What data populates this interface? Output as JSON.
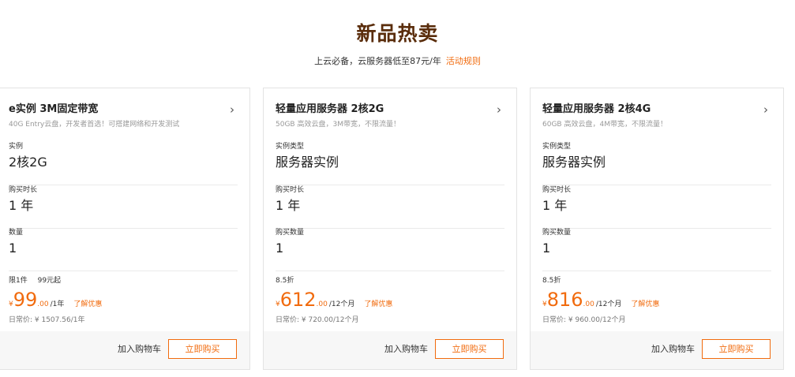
{
  "header": {
    "title": "新品热卖",
    "subtitle": "上云必备，云服务器低至87元/年",
    "rule_link": "活动规则"
  },
  "colors": {
    "accent": "#f16b0e",
    "title": "#5a2d0c"
  },
  "cards": [
    {
      "title": "e实例 3M固定带宽",
      "desc": "40G Entry云盘，开发者首选！可搭建网络和开发测试",
      "arrow": "›",
      "fields": [
        {
          "label": "实例",
          "value": "2核2G"
        },
        {
          "label": "购买时长",
          "value": "1 年"
        },
        {
          "label": "数量",
          "value": "1"
        }
      ],
      "tags": [
        "限1件",
        "99元起"
      ],
      "price": {
        "yen": "¥",
        "int": "99",
        "dec": ".00",
        "unit": "/1年"
      },
      "discount": "了解优惠",
      "original": "日常价: ¥ 1507.56/1年",
      "cart_label": "加入购物车",
      "buy_label": "立即购买"
    },
    {
      "title": "轻量应用服务器 2核2G",
      "desc": "50GB 高效云盘，3M带宽，不限流量！",
      "arrow": "›",
      "fields": [
        {
          "label": "实例类型",
          "value": "服务器实例"
        },
        {
          "label": "购买时长",
          "value": "1 年"
        },
        {
          "label": "购买数量",
          "value": "1"
        }
      ],
      "tags": [
        "8.5折"
      ],
      "price": {
        "yen": "¥",
        "int": "612",
        "dec": ".00",
        "unit": "/12个月"
      },
      "discount": "了解优惠",
      "original": "日常价: ¥ 720.00/12个月",
      "cart_label": "加入购物车",
      "buy_label": "立即购买"
    },
    {
      "title": "轻量应用服务器 2核4G",
      "desc": "60GB 高效云盘，4M带宽，不限流量！",
      "arrow": "›",
      "fields": [
        {
          "label": "实例类型",
          "value": "服务器实例"
        },
        {
          "label": "购买时长",
          "value": "1 年"
        },
        {
          "label": "购买数量",
          "value": "1"
        }
      ],
      "tags": [
        "8.5折"
      ],
      "price": {
        "yen": "¥",
        "int": "816",
        "dec": ".00",
        "unit": "/12个月"
      },
      "discount": "了解优惠",
      "original": "日常价: ¥ 960.00/12个月",
      "cart_label": "加入购物车",
      "buy_label": "立即购买"
    }
  ]
}
